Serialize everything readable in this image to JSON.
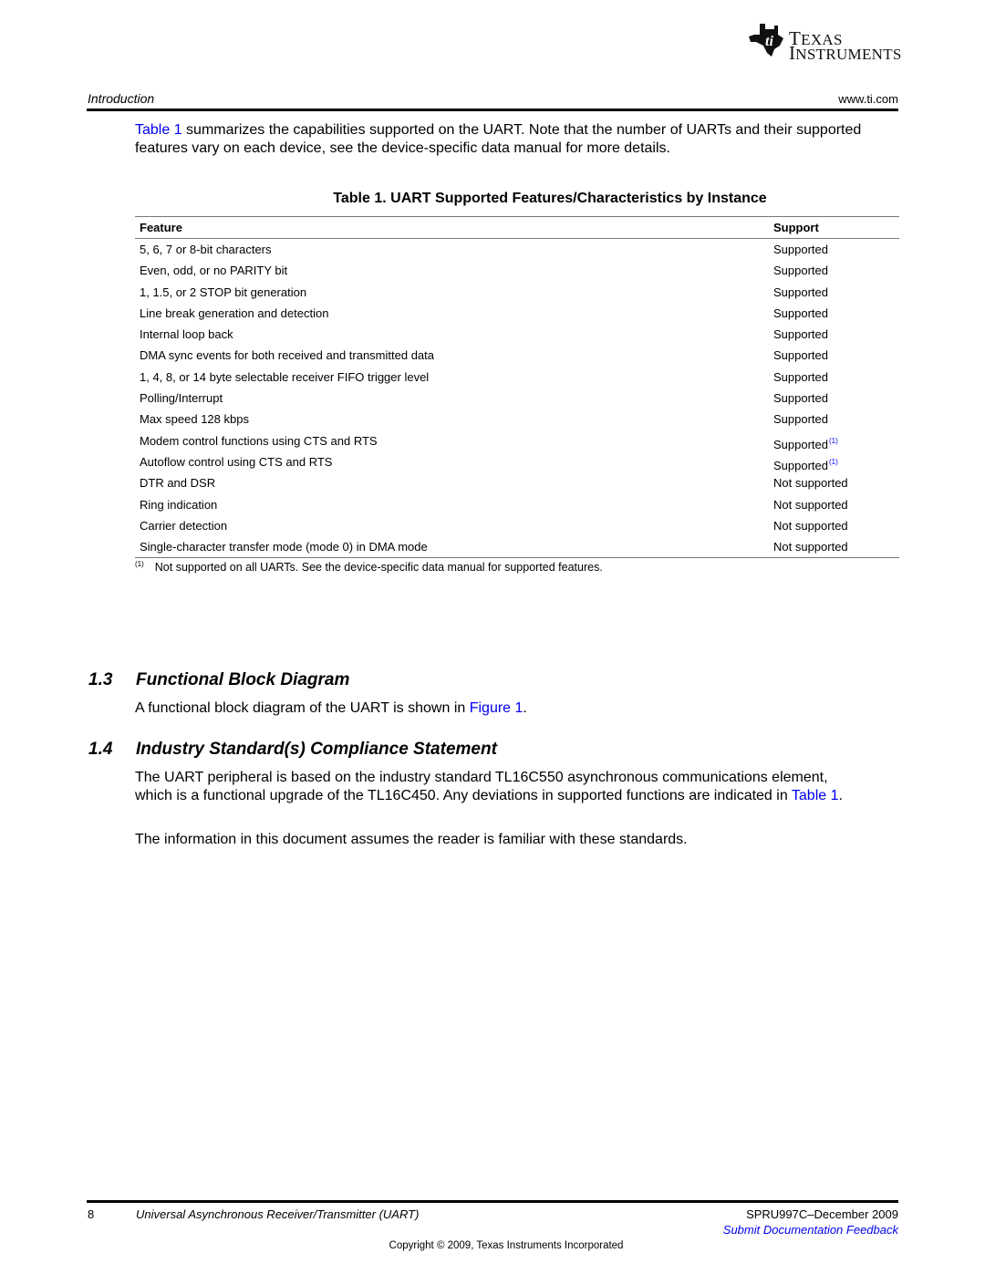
{
  "logo": {
    "icon": "ti-state-bug-icon",
    "line1_first": "T",
    "line1_rest": "EXAS",
    "line2_first": "I",
    "line2_rest": "NSTRUMENTS"
  },
  "header": {
    "section": "Introduction",
    "url": "www.ti.com"
  },
  "intro": {
    "link": "Table 1",
    "text": " summarizes the capabilities supported on the UART. Note that the number of UARTs and their supported features vary on each device, see the device-specific data manual for more details."
  },
  "table": {
    "title": "Table 1. UART Supported Features/Characteristics by Instance",
    "headers": [
      "Feature",
      "Support"
    ],
    "rows": [
      {
        "feature": "5, 6, 7 or 8-bit characters",
        "support": "Supported",
        "footnote": ""
      },
      {
        "feature": "Even, odd, or no PARITY bit",
        "support": "Supported",
        "footnote": ""
      },
      {
        "feature": "1, 1.5, or 2 STOP bit generation",
        "support": "Supported",
        "footnote": ""
      },
      {
        "feature": "Line break generation and detection",
        "support": "Supported",
        "footnote": ""
      },
      {
        "feature": "Internal loop back",
        "support": "Supported",
        "footnote": ""
      },
      {
        "feature": "DMA sync events for both received and transmitted data",
        "support": "Supported",
        "footnote": ""
      },
      {
        "feature": "1, 4, 8, or 14 byte selectable receiver FIFO trigger level",
        "support": "Supported",
        "footnote": ""
      },
      {
        "feature": "Polling/Interrupt",
        "support": "Supported",
        "footnote": ""
      },
      {
        "feature": "Max speed 128 kbps",
        "support": "Supported",
        "footnote": ""
      },
      {
        "feature": "Modem control functions using CTS and RTS",
        "support": "Supported",
        "footnote": "(1)"
      },
      {
        "feature": "Autoflow control using CTS and RTS",
        "support": "Supported",
        "footnote": "(1)"
      },
      {
        "feature": "DTR and DSR",
        "support": "Not supported",
        "footnote": ""
      },
      {
        "feature": "Ring indication",
        "support": "Not supported",
        "footnote": ""
      },
      {
        "feature": "Carrier detection",
        "support": "Not supported",
        "footnote": ""
      },
      {
        "feature": "Single-character transfer mode (mode 0) in DMA mode",
        "support": "Not supported",
        "footnote": ""
      }
    ],
    "footnote_mark": "(1)",
    "footnote_text": "Not supported on all UARTs. See the device-specific data manual for supported features."
  },
  "section_1_3": {
    "number": "1.3",
    "title": "Functional Block Diagram",
    "text_before": "A functional block diagram of the UART is shown in ",
    "link": "Figure 1",
    "text_after": "."
  },
  "section_1_4": {
    "number": "1.4",
    "title": "Industry Standard(s) Compliance Statement",
    "para1_before": "The UART peripheral is based on the industry standard TL16C550 asynchronous communications element, which is a functional upgrade of the TL16C450. Any deviations in supported functions are indicated in ",
    "para1_link": "Table 1",
    "para1_after": ".",
    "para2": "The information in this document assumes the reader is familiar with these standards."
  },
  "footer": {
    "page_number": "8",
    "doc_title": "Universal Asynchronous Receiver/Transmitter (UART)",
    "doc_id": "SPRU997C–December 2009",
    "feedback_link": "Submit Documentation Feedback",
    "copyright": "Copyright © 2009, Texas Instruments Incorporated"
  },
  "colors": {
    "link": "#0000ee",
    "text": "#000000"
  }
}
